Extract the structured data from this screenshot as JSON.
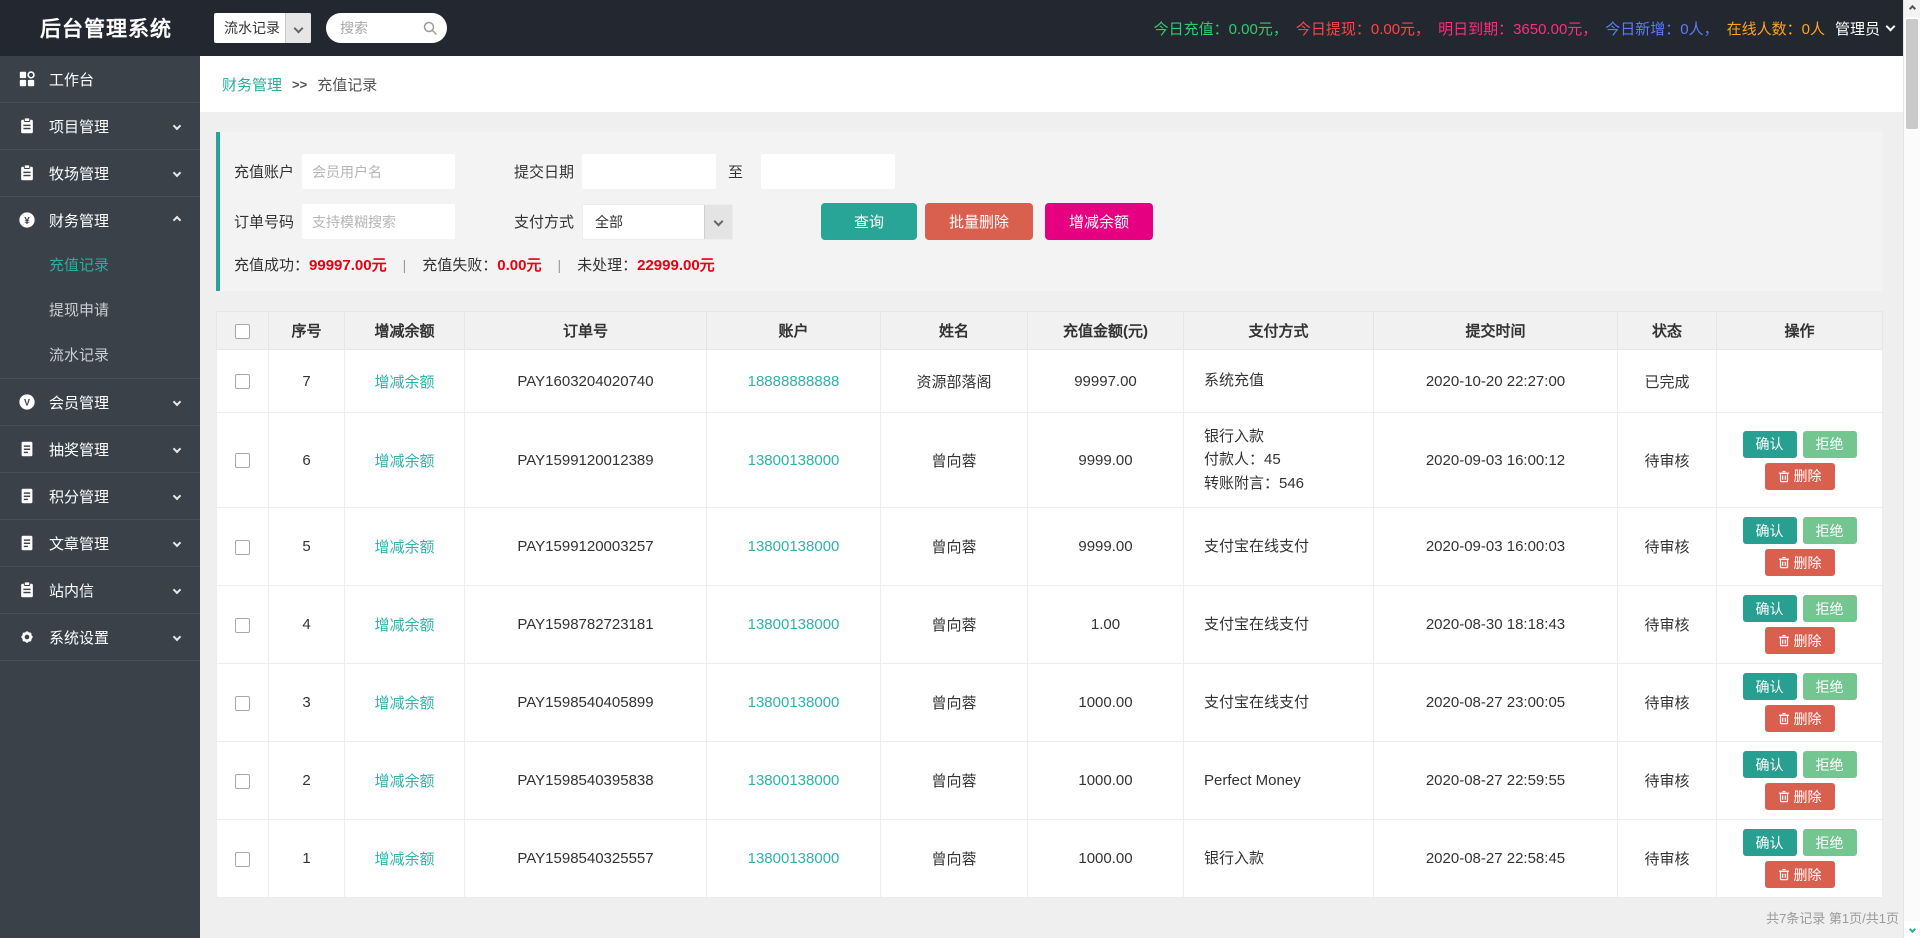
{
  "topbar": {
    "title": "后台管理系统",
    "module_select": {
      "value": "流水记录"
    },
    "search": {
      "placeholder": "搜索"
    },
    "stats": [
      {
        "text": "今日充值：0.00元，",
        "color": "#2ecc71"
      },
      {
        "text": "今日提现：0.00元，",
        "color": "#ff4545"
      },
      {
        "text": "明日到期：3650.00元，",
        "color": "#ff2d7d"
      },
      {
        "text": "今日新增：0人，",
        "color": "#5b7cfa"
      },
      {
        "text": "在线人数：0人",
        "color": "#ffa41b"
      }
    ],
    "admin": "管理员"
  },
  "sidebar": {
    "items": [
      {
        "label": "工作台",
        "icon": "dashboard",
        "chevron": "none",
        "children": []
      },
      {
        "label": "项目管理",
        "icon": "clipboard",
        "chevron": "down",
        "children": []
      },
      {
        "label": "牧场管理",
        "icon": "clipboard",
        "chevron": "down",
        "children": []
      },
      {
        "label": "财务管理",
        "icon": "finance",
        "chevron": "up",
        "children": [
          {
            "label": "充值记录",
            "active": true
          },
          {
            "label": "提现申请",
            "active": false
          },
          {
            "label": "流水记录",
            "active": false
          }
        ]
      },
      {
        "label": "会员管理",
        "icon": "member",
        "chevron": "down",
        "children": []
      },
      {
        "label": "抽奖管理",
        "icon": "doc",
        "chevron": "down",
        "children": []
      },
      {
        "label": "积分管理",
        "icon": "doc",
        "chevron": "down",
        "children": []
      },
      {
        "label": "文章管理",
        "icon": "doc",
        "chevron": "down",
        "children": []
      },
      {
        "label": "站内信",
        "icon": "clipboard",
        "chevron": "down",
        "children": []
      },
      {
        "label": "系统设置",
        "icon": "gear",
        "chevron": "down",
        "children": []
      }
    ]
  },
  "breadcrumb": {
    "parent": "财务管理",
    "separator": ">>",
    "current": "充值记录"
  },
  "filter": {
    "account_label": "充值账户",
    "account_placeholder": "会员用户名",
    "date_label": "提交日期",
    "date_to_label": "至",
    "order_label": "订单号码",
    "order_placeholder": "支持模糊搜索",
    "payment_label": "支付方式",
    "payment_selected": "全部",
    "query_button": "查询",
    "batch_delete_button": "批量删除",
    "adjust_button": "增减余额"
  },
  "summary": [
    {
      "label": "充值成功：",
      "value": "99997.00元"
    },
    {
      "label": "充值失败：",
      "value": "0.00元"
    },
    {
      "label": "未处理：",
      "value": "22999.00元"
    }
  ],
  "table": {
    "columns": [
      "序号",
      "增减余额",
      "订单号",
      "账户",
      "姓名",
      "充值金额(元)",
      "支付方式",
      "提交时间",
      "状态",
      "操作"
    ],
    "adjust_link": "增减余额",
    "action_labels": {
      "confirm": "确认",
      "reject": "拒绝",
      "delete": "删除"
    },
    "rows": [
      {
        "seq": "7",
        "order_no": "PAY1603204020740",
        "account": "18888888888",
        "name": "资源部落阁",
        "amount": "99997.00",
        "payment_lines": [
          "系统充值"
        ],
        "time": "2020-10-20 22:27:00",
        "status": "已完成",
        "has_actions": false
      },
      {
        "seq": "6",
        "order_no": "PAY1599120012389",
        "account": "13800138000",
        "name": "曾向蓉",
        "amount": "9999.00",
        "payment_lines": [
          "银行入款",
          "付款人：45",
          "转账附言：546"
        ],
        "time": "2020-09-03 16:00:12",
        "status": "待审核",
        "has_actions": true
      },
      {
        "seq": "5",
        "order_no": "PAY1599120003257",
        "account": "13800138000",
        "name": "曾向蓉",
        "amount": "9999.00",
        "payment_lines": [
          "支付宝在线支付"
        ],
        "time": "2020-09-03 16:00:03",
        "status": "待审核",
        "has_actions": true
      },
      {
        "seq": "4",
        "order_no": "PAY1598782723181",
        "account": "13800138000",
        "name": "曾向蓉",
        "amount": "1.00",
        "payment_lines": [
          "支付宝在线支付"
        ],
        "time": "2020-08-30 18:18:43",
        "status": "待审核",
        "has_actions": true
      },
      {
        "seq": "3",
        "order_no": "PAY1598540405899",
        "account": "13800138000",
        "name": "曾向蓉",
        "amount": "1000.00",
        "payment_lines": [
          "支付宝在线支付"
        ],
        "time": "2020-08-27 23:00:05",
        "status": "待审核",
        "has_actions": true
      },
      {
        "seq": "2",
        "order_no": "PAY1598540395838",
        "account": "13800138000",
        "name": "曾向蓉",
        "amount": "1000.00",
        "payment_lines": [
          "Perfect Money"
        ],
        "time": "2020-08-27 22:59:55",
        "status": "待审核",
        "has_actions": true
      },
      {
        "seq": "1",
        "order_no": "PAY1598540325557",
        "account": "13800138000",
        "name": "曾向蓉",
        "amount": "1000.00",
        "payment_lines": [
          "银行入款"
        ],
        "time": "2020-08-27 22:58:45",
        "status": "待审核",
        "has_actions": true
      }
    ]
  },
  "footer": {
    "text": "共7条记录 第1页/共1页"
  },
  "colors": {
    "topbar_bg": "#23272f",
    "sidebar_bg": "#3a4149",
    "accent_teal": "#28a596",
    "link_teal": "#2fb3a9",
    "danger_red": "#e60012",
    "button_red": "#d9604e",
    "button_magenta": "#e50081",
    "reject_green": "#74c691"
  }
}
